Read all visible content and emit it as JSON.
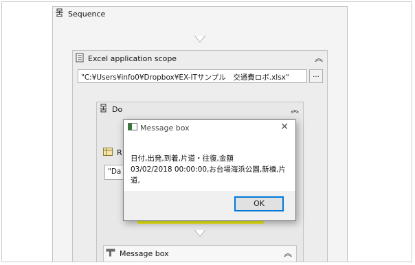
{
  "sequence": {
    "title": "Sequence",
    "icon": "sequence-icon"
  },
  "excel_scope": {
    "title": "Excel application scope",
    "icon": "excel-document-icon",
    "file_path": "\"C:¥Users¥info0¥Dropbox¥EX-ITサンプル　交通費ロボ.xlsx\"",
    "browse_label": "..."
  },
  "do": {
    "title": "Do",
    "icon": "sequence-icon"
  },
  "read_range": {
    "title_fragment": "R",
    "input_fragment": "\"Da"
  },
  "message_box_activity": {
    "title": "Message box",
    "icon": "message-box-icon"
  },
  "dialog": {
    "title": "Message box",
    "line1": "日付,出発,到着,片道・往復,金額",
    "line2": "03/02/2018 00:00:00,お台場海浜公園,新橋,片道,",
    "ok_label": "OK"
  },
  "colors": {
    "accent": "#0078d7",
    "highlight": "#f2f21f"
  }
}
